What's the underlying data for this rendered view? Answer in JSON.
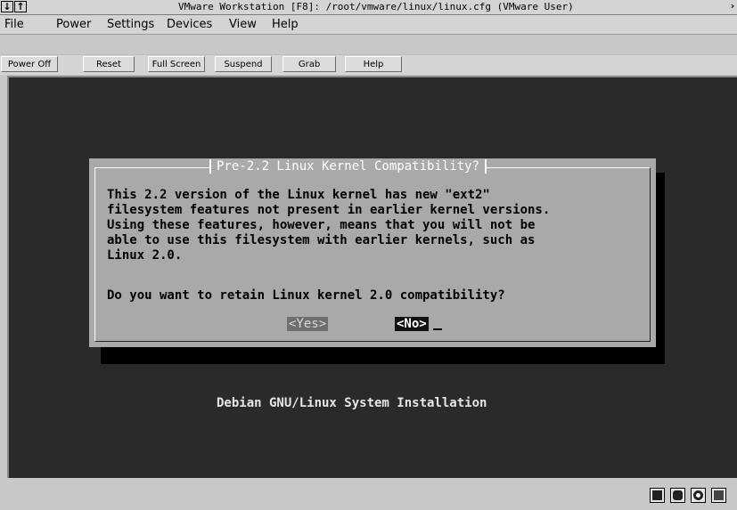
{
  "window": {
    "title": "VMware Workstation [F8]: /root/vmware/linux/linux.cfg (VMware User)",
    "arrow_down": "↓",
    "arrow_up": "↑",
    "right_arrow": "›"
  },
  "menu": {
    "items": [
      {
        "label": "File"
      },
      {
        "label": "Power"
      },
      {
        "label": "Settings"
      },
      {
        "label": "Devices"
      },
      {
        "label": "View"
      },
      {
        "label": "Help"
      }
    ]
  },
  "toolbar": {
    "buttons": [
      {
        "label": "Power Off"
      },
      {
        "label": "Reset"
      },
      {
        "label": "Full Screen"
      },
      {
        "label": "Suspend"
      },
      {
        "label": "Grab"
      },
      {
        "label": "Help"
      }
    ]
  },
  "dialog": {
    "title": "Pre-2.2 Linux Kernel Compatibility?",
    "body": "This 2.2 version of the Linux kernel has new \"ext2\"\nfilesystem features not present in earlier kernel versions.\nUsing these features, however, means that you will not be\nable to use this filesystem with earlier kernels, such as\nLinux 2.0.",
    "question": "Do you want to retain Linux kernel 2.0 compatibility?",
    "yes_label": "<Yes>",
    "no_label": "<No>"
  },
  "screen": {
    "footer": "Debian GNU/Linux System Installation"
  },
  "status": {
    "icons": [
      "disk-icon",
      "drive-icon",
      "cdrom-icon",
      "network-icon"
    ]
  }
}
